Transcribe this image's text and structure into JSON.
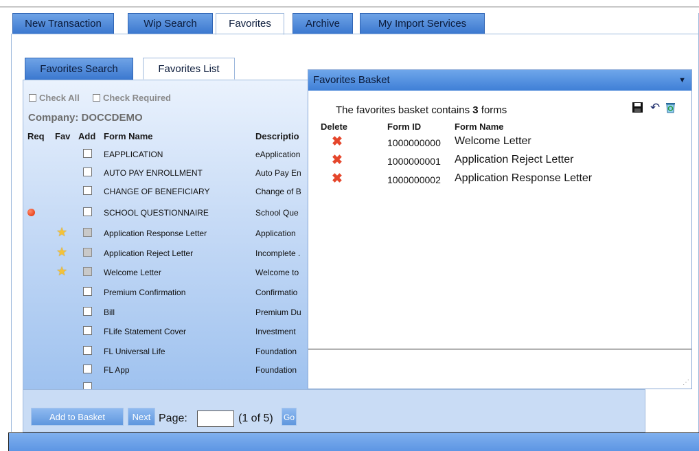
{
  "main_tabs": [
    {
      "label": "New Transaction",
      "active": false
    },
    {
      "label": "Wip Search",
      "active": false
    },
    {
      "label": "Favorites",
      "active": true
    },
    {
      "label": "Archive",
      "active": false
    },
    {
      "label": "My Import Services",
      "active": false
    }
  ],
  "sub_tabs": [
    {
      "label": "Favorites Search",
      "active": false
    },
    {
      "label": "Favorites List",
      "active": true
    }
  ],
  "list": {
    "check_all": "Check All",
    "check_required": "Check Required",
    "company": "Company: DOCCDEMO",
    "headers": {
      "req": "Req",
      "fav": "Fav",
      "add": "Add",
      "form_name": "Form Name",
      "description": "Descriptio"
    },
    "rows": [
      {
        "name": "EAPPLICATION",
        "desc": "eApplication",
        "req": false,
        "fav": false,
        "disabled": false
      },
      {
        "name": "AUTO PAY ENROLLMENT",
        "desc": "Auto Pay En",
        "req": false,
        "fav": false,
        "disabled": false
      },
      {
        "name": "CHANGE OF BENEFICIARY",
        "desc": "Change of B",
        "req": false,
        "fav": false,
        "disabled": false
      },
      {
        "name": "SCHOOL QUESTIONNAIRE",
        "desc": "School Que",
        "req": true,
        "fav": false,
        "disabled": false
      },
      {
        "name": "Application Response Letter",
        "desc": "Application",
        "req": false,
        "fav": true,
        "disabled": true
      },
      {
        "name": "Application Reject Letter",
        "desc": "Incomplete .",
        "req": false,
        "fav": true,
        "disabled": true
      },
      {
        "name": "Welcome Letter",
        "desc": "Welcome to",
        "req": false,
        "fav": true,
        "disabled": true
      },
      {
        "name": "Premium Confirmation",
        "desc": "Confirmatio",
        "req": false,
        "fav": false,
        "disabled": false
      },
      {
        "name": "Bill",
        "desc": "Premium Du",
        "req": false,
        "fav": false,
        "disabled": false
      },
      {
        "name": "FLife Statement Cover",
        "desc": "Investment",
        "req": false,
        "fav": false,
        "disabled": false
      },
      {
        "name": "FL Universal Life",
        "desc": "Foundation",
        "req": false,
        "fav": false,
        "disabled": false
      },
      {
        "name": "FL App",
        "desc": "Foundation",
        "req": false,
        "fav": false,
        "disabled": false
      }
    ]
  },
  "pager": {
    "add_to_basket": "Add to Basket",
    "next": "Next",
    "page_label": "Page:",
    "page_value": "",
    "page_count": "(1 of 5)",
    "go": "Go"
  },
  "basket": {
    "title": "Favorites Basket",
    "contains_prefix": "The favorites basket contains ",
    "count": "3",
    "contains_suffix": " forms",
    "headers": {
      "delete": "Delete",
      "form_id": "Form ID",
      "form_name": "Form Name"
    },
    "items": [
      {
        "id": "1000000000",
        "name": "Welcome Letter"
      },
      {
        "id": "1000000001",
        "name": "Application Reject Letter"
      },
      {
        "id": "1000000002",
        "name": "Application Response Letter"
      }
    ],
    "icons": [
      "save-icon",
      "undo-icon",
      "recycle-icon"
    ]
  },
  "colors": {
    "tab_blue": "#3b78cf",
    "panel_blue": "#9fc2ef",
    "delete_red": "#e5462b",
    "required_red": "#e02a00",
    "star_yellow": "#f3c23a"
  }
}
